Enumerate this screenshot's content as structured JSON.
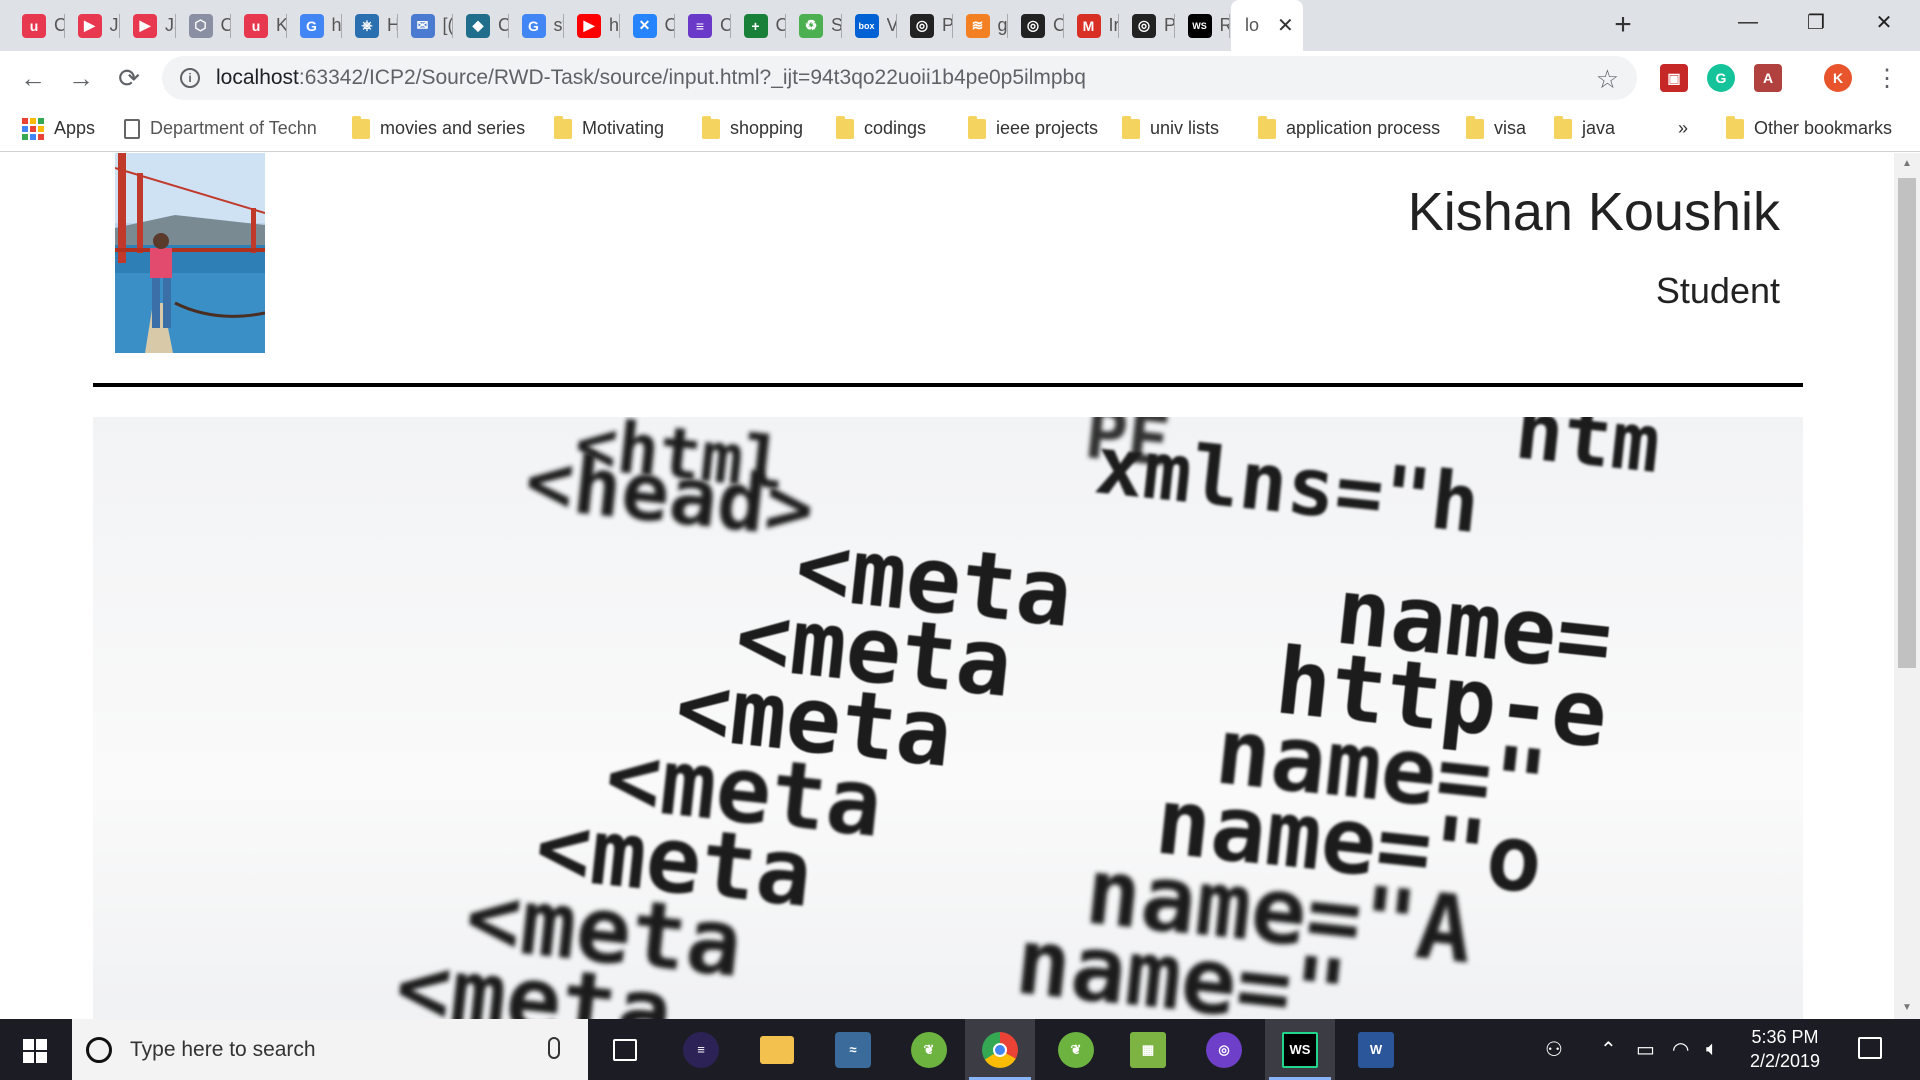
{
  "browser": {
    "tabs": [
      {
        "letter": "u",
        "title": "C",
        "color": "#e8384f"
      },
      {
        "letter": "▶",
        "title": "Ja",
        "color": "#e8384f"
      },
      {
        "letter": "▶",
        "title": "Ja",
        "color": "#e8384f"
      },
      {
        "letter": "⬡",
        "title": "C",
        "color": "#8a8fa3"
      },
      {
        "letter": "u",
        "title": "K",
        "color": "#e8384f"
      },
      {
        "letter": "G",
        "title": "h",
        "color": "#4285f4"
      },
      {
        "letter": "⎈",
        "title": "H",
        "color": "#2a6fb0"
      },
      {
        "letter": "✉",
        "title": "[(",
        "color": "#4a7bd0"
      },
      {
        "letter": "◆",
        "title": "C",
        "color": "#1f6e8c"
      },
      {
        "letter": "G",
        "title": "st",
        "color": "#4285f4"
      },
      {
        "letter": "▶",
        "title": "h",
        "color": "#ff0000"
      },
      {
        "letter": "✕",
        "title": "C",
        "color": "#2684ff"
      },
      {
        "letter": "≡",
        "title": "C",
        "color": "#6b39c8"
      },
      {
        "letter": "+",
        "title": "C",
        "color": "#188038"
      },
      {
        "letter": "♻",
        "title": "S",
        "color": "#4caf50"
      },
      {
        "letter": "box",
        "title": "V",
        "color": "#0061d5"
      },
      {
        "letter": "◎",
        "title": "P",
        "color": "#222"
      },
      {
        "letter": "≋",
        "title": "g",
        "color": "#f48024"
      },
      {
        "letter": "◎",
        "title": "C",
        "color": "#222"
      },
      {
        "letter": "M",
        "title": "Ir",
        "color": "#d93025"
      },
      {
        "letter": "◎",
        "title": "P",
        "color": "#222"
      },
      {
        "letter": "WS",
        "title": "R",
        "color": "#000"
      }
    ],
    "active_tab": {
      "title": "lo",
      "close": "✕"
    },
    "new_tab": "+",
    "window_controls": {
      "minimize": "—",
      "restore": "❐",
      "close": "✕"
    },
    "back": "←",
    "forward": "→",
    "reload": "⟳",
    "url_host": "localhost",
    "url_rest": ":63342/ICP2/Source/RWD-Task/source/input.html?_ijt=94t3qo22uoii1b4pe0p5ilmpbq",
    "star": "☆",
    "profile_letter": "K",
    "menu": "⋮"
  },
  "bookmarks": {
    "apps": "Apps",
    "items": [
      "Department of Techn",
      "movies and series",
      "Motivating",
      "shopping",
      "codings",
      "ieee projects",
      "univ lists",
      "application process",
      "visa",
      "java"
    ],
    "overflow": "»",
    "other": "Other bookmarks"
  },
  "page": {
    "name": "Kishan Koushik",
    "role": "Student",
    "banner_code": [
      "<html xmlns=\"h",
      "<head>",
      "<meta name=",
      "<meta http-e",
      "<meta name=\"",
      "<meta name=\"o",
      "<meta name=\"A",
      "<meta name=\""
    ]
  },
  "taskbar": {
    "search_placeholder": "Type here to search",
    "time": "5:36 PM",
    "date": "2/2/2019"
  }
}
